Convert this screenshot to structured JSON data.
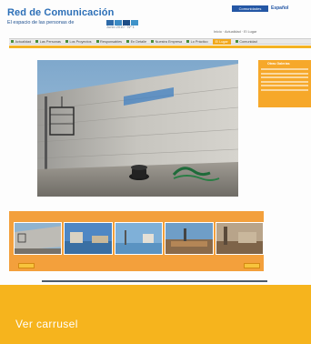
{
  "header": {
    "title": "Red de Comunicación",
    "subtitle": "El espacio de las personas de",
    "issue": "Junio 2010 · Nº 1",
    "top_button": "Comunidades",
    "language": "Español"
  },
  "breadcrumb": "Inicio · Actualidad · El Lugar",
  "nav": [
    {
      "label": "Actualidad",
      "icon": "square-icon"
    },
    {
      "label": "Las Personas",
      "icon": "square-icon"
    },
    {
      "label": "Los Proyectos",
      "icon": "square-icon"
    },
    {
      "label": "Responsables",
      "icon": "square-icon"
    },
    {
      "label": "En Detalle",
      "icon": "square-icon"
    },
    {
      "label": "Nuestra Empresa",
      "icon": "square-icon"
    },
    {
      "label": "Lo Práctico",
      "icon": "square-icon"
    },
    {
      "label": "El Lugar",
      "icon": "square-icon",
      "active": true
    },
    {
      "label": "Comunidad",
      "icon": "square-icon"
    }
  ],
  "side_panel": {
    "title": "Otras Galerías"
  },
  "caption": {
    "text": "Ver carrusel"
  },
  "colors": {
    "accent_orange": "#f6b41d",
    "brand_blue": "#2c6fb7",
    "carousel_orange": "#f3a03c"
  }
}
